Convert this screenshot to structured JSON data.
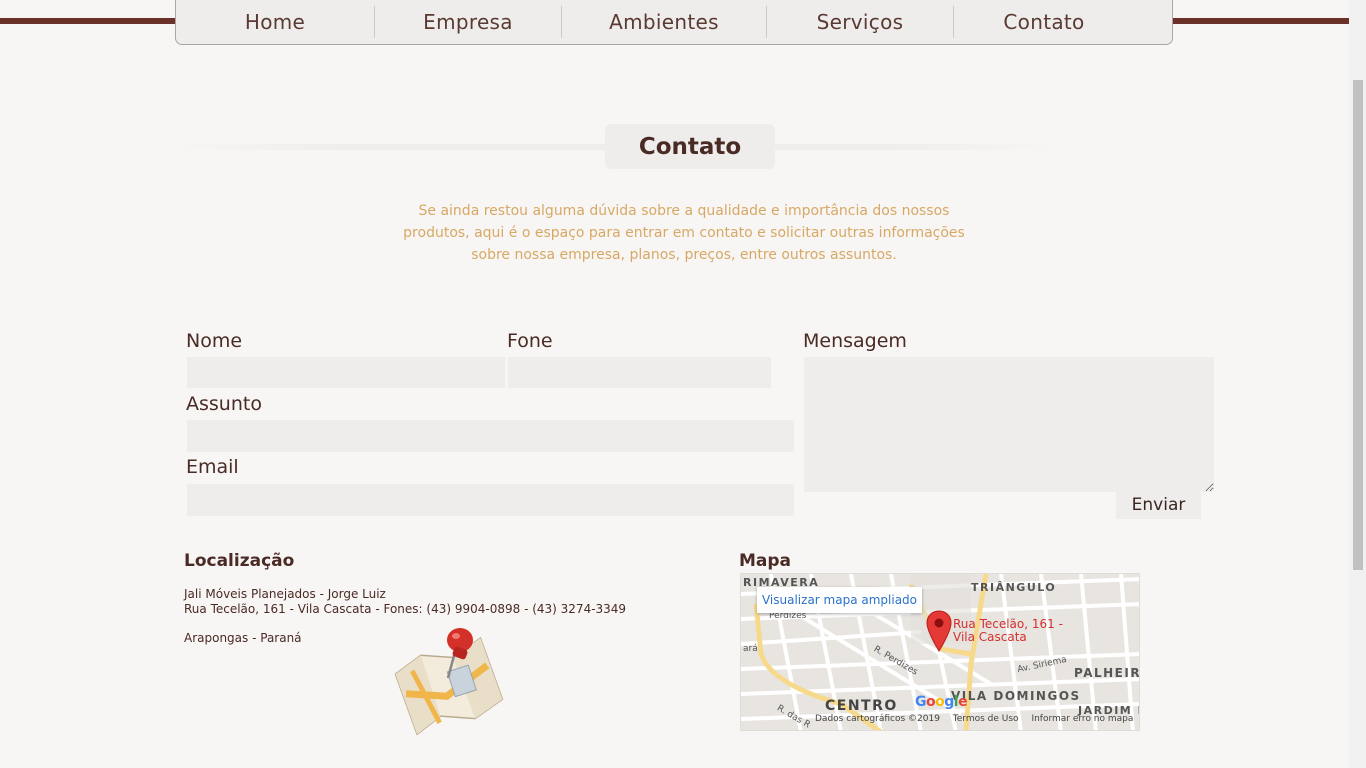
{
  "nav": {
    "items": [
      {
        "label": "Home"
      },
      {
        "label": "Empresa"
      },
      {
        "label": "Ambientes"
      },
      {
        "label": "Serviços"
      },
      {
        "label": "Contato"
      }
    ]
  },
  "contact": {
    "title": "Contato",
    "intro": "Se ainda restou alguma dúvida sobre a qualidade e importância dos nossos produtos, aqui é o espaço para entrar em contato e solicitar outras informações sobre nossa empresa, planos, preços, entre outros assuntos."
  },
  "form": {
    "name_label": "Nome",
    "phone_label": "Fone",
    "subject_label": "Assunto",
    "email_label": "Email",
    "message_label": "Mensagem",
    "name_value": "",
    "phone_value": "",
    "subject_value": "",
    "email_value": "",
    "message_value": "",
    "submit_label": "Enviar"
  },
  "location": {
    "title": "Localização",
    "line1": "Jali Móveis Planejados - Jorge Luiz",
    "line2": "Rua Tecelão, 161 - Vila Cascata - Fones: (43) 9904-0898 - (43) 3274-3349",
    "line3": "Arapongas - Paraná",
    "icon": "map-pin-icon"
  },
  "map": {
    "title": "Mapa",
    "view_larger": "Visualizar mapa ampliado",
    "pin_label": "Rua Tecelão, 161 - Vila Cascata",
    "labels": {
      "primavera": "RIMAVERA",
      "triangulo": "TRIÂNGULO",
      "centro": "CENTRO",
      "vila_domingos": "VILA DOMINGOS",
      "palheir": "PALHEIR",
      "jardim": "JARDIM N",
      "perdizes": "R. Perdizes",
      "perdizes_top": "Perdizes",
      "siriema": "Av. Siriema",
      "das": "R. das R",
      "ara": "ará"
    },
    "google": "Google",
    "footer": {
      "data": "Dados cartográficos ©2019",
      "terms": "Termos de Uso",
      "report": "Informar erro no mapa"
    },
    "colors": {
      "pin": "#e53935",
      "road": "#f6d98a",
      "link": "#2a72c9"
    }
  }
}
